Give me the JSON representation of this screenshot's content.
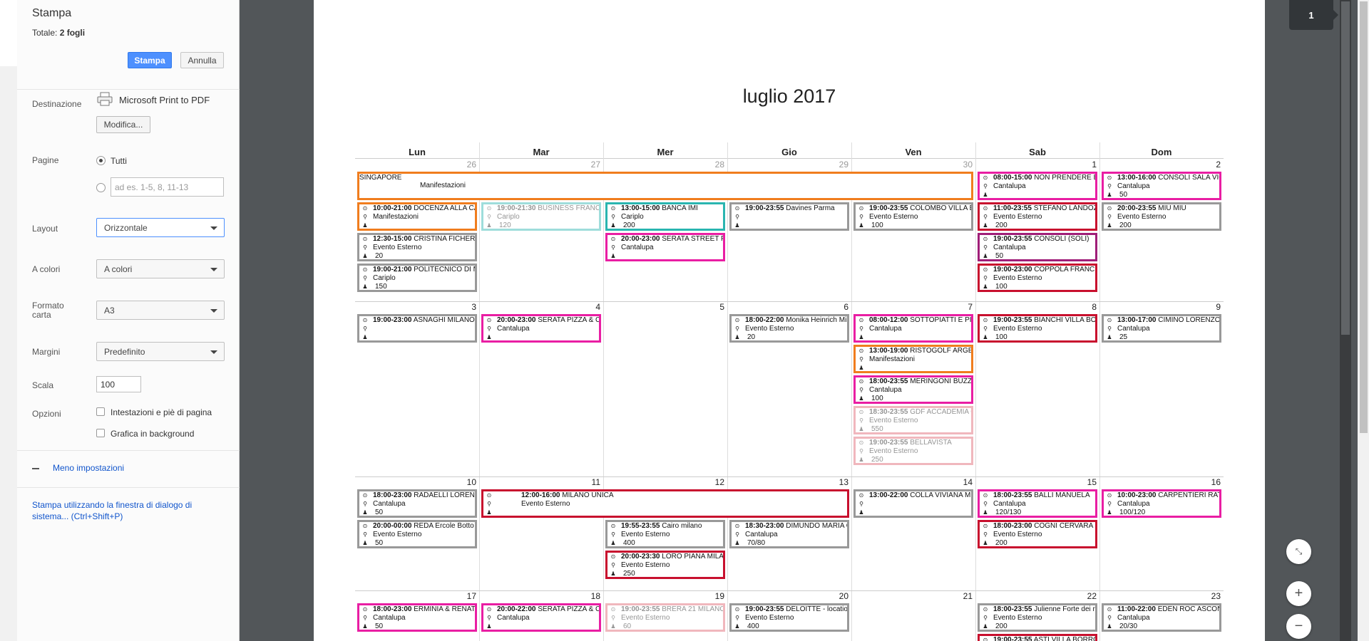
{
  "print_panel": {
    "title": "Stampa",
    "total_label": "Totale:",
    "total_value": "2 fogli",
    "print_button": "Stampa",
    "cancel_button": "Annulla",
    "destination_label": "Destinazione",
    "destination_value": "Microsoft Print to PDF",
    "modify_button": "Modifica...",
    "pages_label": "Pagine",
    "pages_all": "Tutti",
    "pages_range_placeholder": "ad es. 1-5, 8, 11-13",
    "layout_label": "Layout",
    "layout_value": "Orizzontale",
    "color_label": "A colori",
    "color_value": "A colori",
    "paper_label": "Formato carta",
    "paper_value": "A3",
    "margins_label": "Margini",
    "margins_value": "Predefinito",
    "scale_label": "Scala",
    "scale_value": "100",
    "options_label": "Opzioni",
    "option_headers": "Intestazioni e piè di pagina",
    "option_background": "Grafica in background",
    "less_settings": "Meno impostazioni",
    "system_dialog": "Stampa utilizzando la finestra di dialogo di sistema... (Ctrl+Shift+P)"
  },
  "viewer": {
    "page_number": "1",
    "fit_icon": "fit-page-icon",
    "zoom_in": "+",
    "zoom_out": "−"
  },
  "calendar": {
    "title": "luglio 2017",
    "days": [
      "Lun",
      "Mar",
      "Mer",
      "Gio",
      "Ven",
      "Sab",
      "Dom"
    ],
    "weeks": [
      {
        "dates": [
          "26",
          "27",
          "28",
          "29",
          "30",
          "1",
          "2"
        ],
        "other": [
          true,
          true,
          true,
          true,
          true,
          false,
          false
        ]
      },
      {
        "dates": [
          "3",
          "4",
          "5",
          "6",
          "7",
          "8",
          "9"
        ],
        "other": [
          false,
          false,
          false,
          false,
          false,
          false,
          false
        ]
      },
      {
        "dates": [
          "10",
          "11",
          "12",
          "13",
          "14",
          "15",
          "16"
        ],
        "other": [
          false,
          false,
          false,
          false,
          false,
          false,
          false
        ]
      },
      {
        "dates": [
          "17",
          "18",
          "19",
          "20",
          "21",
          "22",
          "23"
        ],
        "other": [
          false,
          false,
          false,
          false,
          false,
          false,
          false
        ]
      }
    ],
    "events": [
      {
        "week": 0,
        "col": 0,
        "span": 5,
        "row": 0,
        "color": "#f07d1e",
        "time": "",
        "title": "SINGAPORE",
        "place": "Manifestazioni",
        "people": "",
        "singlespan": true
      },
      {
        "week": 0,
        "col": 5,
        "span": 1,
        "row": 0,
        "color": "#e91ea3",
        "time": "08:00-15:00",
        "title": "NON PRENDERE BANQ",
        "place": "Cantalupa",
        "people": ""
      },
      {
        "week": 0,
        "col": 6,
        "span": 1,
        "row": 0,
        "color": "#e91ea3",
        "time": "13:00-16:00",
        "title": "CONSOLI SALA VIGNE",
        "place": "Cantalupa",
        "people": "50"
      },
      {
        "week": 0,
        "col": 0,
        "span": 1,
        "row": 1,
        "color": "#f07d1e",
        "time": "10:00-21:00",
        "title": "DOCENZA ALLA CATTO",
        "place": "Manifestazioni",
        "people": ""
      },
      {
        "week": 0,
        "col": 1,
        "span": 1,
        "row": 1,
        "color": "#2ab5b0",
        "time": "19:00-21:30",
        "title": "BUSINESS FRANCE",
        "place": "Cariplo",
        "people": "120",
        "faded": true
      },
      {
        "week": 0,
        "col": 2,
        "span": 1,
        "row": 1,
        "color": "#2ab5b0",
        "time": "13:00-15:00",
        "title": "BANCA IMI",
        "place": "Cariplo",
        "people": "200"
      },
      {
        "week": 0,
        "col": 3,
        "span": 1,
        "row": 1,
        "color": "#999999",
        "time": "19:00-23:55",
        "title": "Davines Parma",
        "place": "",
        "people": ""
      },
      {
        "week": 0,
        "col": 4,
        "span": 1,
        "row": 1,
        "color": "#999999",
        "time": "19:00-23:55",
        "title": "COLOMBO VILLA BOR",
        "place": "Evento Esterno",
        "people": "100"
      },
      {
        "week": 0,
        "col": 5,
        "span": 1,
        "row": 1,
        "color": "#c8102e",
        "time": "11:00-23:55",
        "title": "STEFANO LANDOZZI U",
        "place": "Evento Esterno",
        "people": "200"
      },
      {
        "week": 0,
        "col": 6,
        "span": 1,
        "row": 1,
        "color": "#999999",
        "time": "20:00-23:55",
        "title": "MIU MIU",
        "place": "Evento Esterno",
        "people": "200"
      },
      {
        "week": 0,
        "col": 0,
        "span": 1,
        "row": 2,
        "color": "#999999",
        "time": "12:30-15:00",
        "title": "CRISTINA FICHERA",
        "place": "Evento Esterno",
        "people": "20"
      },
      {
        "week": 0,
        "col": 2,
        "span": 1,
        "row": 2,
        "color": "#e91ea3",
        "time": "20:00-23:00",
        "title": "SERATA STREET FOOD",
        "place": "Cantalupa",
        "people": ""
      },
      {
        "week": 0,
        "col": 5,
        "span": 1,
        "row": 2,
        "color": "#a01e78",
        "time": "19:00-23:55",
        "title": "CONSOLI (SOLI)",
        "place": "Cantalupa",
        "people": "50"
      },
      {
        "week": 0,
        "col": 0,
        "span": 1,
        "row": 3,
        "color": "#999999",
        "time": "19:00-21:00",
        "title": "POLITECNICO DI MILA",
        "place": "Cariplo",
        "people": "150"
      },
      {
        "week": 0,
        "col": 5,
        "span": 1,
        "row": 3,
        "color": "#c8102e",
        "time": "19:00-23:00",
        "title": "COPPOLA FRANCESCA",
        "place": "Evento Esterno",
        "people": "100"
      },
      {
        "week": 1,
        "col": 0,
        "span": 1,
        "row": 0,
        "color": "#999999",
        "time": "19:00-23:00",
        "title": "ASNAGHI MILANO",
        "place": "",
        "people": ""
      },
      {
        "week": 1,
        "col": 1,
        "span": 1,
        "row": 0,
        "color": "#e91ea3",
        "time": "20:00-23:00",
        "title": "SERATA PIZZA & CHAM",
        "place": "Cantalupa",
        "people": ""
      },
      {
        "week": 1,
        "col": 3,
        "span": 1,
        "row": 0,
        "color": "#999999",
        "time": "18:00-22:00",
        "title": "Monika Heinrich Mila",
        "place": "Evento Esterno",
        "people": "20"
      },
      {
        "week": 1,
        "col": 4,
        "span": 1,
        "row": 0,
        "color": "#e91ea3",
        "time": "08:00-12:00",
        "title": "SOTTOPIATTI E PIATTI",
        "place": "Cantalupa",
        "people": ""
      },
      {
        "week": 1,
        "col": 5,
        "span": 1,
        "row": 0,
        "color": "#c8102e",
        "time": "19:00-23:55",
        "title": "BIANCHI VILLA BORRO",
        "place": "Evento Esterno",
        "people": "100"
      },
      {
        "week": 1,
        "col": 6,
        "span": 1,
        "row": 0,
        "color": "#999999",
        "time": "13:00-17:00",
        "title": "CIMINO LORENZO CA",
        "place": "Cantalupa",
        "people": "25"
      },
      {
        "week": 1,
        "col": 4,
        "span": 1,
        "row": 1,
        "color": "#f07d1e",
        "time": "13:00-19:00",
        "title": "RISTOGOLF ARGENTA",
        "place": "Manifestazioni",
        "people": ""
      },
      {
        "week": 1,
        "col": 4,
        "span": 1,
        "row": 2,
        "color": "#e91ea3",
        "time": "18:00-23:55",
        "title": "MERINGONI BUZZETT",
        "place": "Cantalupa",
        "people": "100"
      },
      {
        "week": 1,
        "col": 4,
        "span": 1,
        "row": 3,
        "color": "#e0616e",
        "time": "18:30-23:55",
        "title": "GDF ACCADEMIA Città",
        "place": "Evento Esterno",
        "people": "550",
        "faded": true
      },
      {
        "week": 1,
        "col": 4,
        "span": 1,
        "row": 4,
        "color": "#e0616e",
        "time": "19:00-23:55",
        "title": "BELLAVISTA",
        "place": "Evento Esterno",
        "people": "250",
        "faded": true
      },
      {
        "week": 2,
        "col": 0,
        "span": 1,
        "row": 0,
        "color": "#999999",
        "time": "18:00-23:00",
        "title": "RADAELLI LORENZO C",
        "place": "Cantalupa",
        "people": "50"
      },
      {
        "week": 2,
        "col": 1,
        "span": 3,
        "row": 0,
        "color": "#c8102e",
        "time": "12:00-16:00",
        "title": "MILANO UNICA",
        "place": "Evento Esterno",
        "people": "",
        "multispan": true
      },
      {
        "week": 2,
        "col": 4,
        "span": 1,
        "row": 0,
        "color": "#999999",
        "time": "13:00-22:00",
        "title": "COLLA VIVIANA MEDC",
        "place": "",
        "people": ""
      },
      {
        "week": 2,
        "col": 5,
        "span": 1,
        "row": 0,
        "color": "#e91ea3",
        "time": "18:00-23:55",
        "title": "BALLI MANUELA",
        "place": "Cantalupa",
        "people": "120/130"
      },
      {
        "week": 2,
        "col": 6,
        "span": 1,
        "row": 0,
        "color": "#e91ea3",
        "time": "10:00-23:00",
        "title": "CARPENTIERI RATTI",
        "place": "Cantalupa",
        "people": "100/120"
      },
      {
        "week": 2,
        "col": 0,
        "span": 1,
        "row": 1,
        "color": "#999999",
        "time": "20:00-00:00",
        "title": "REDA Ercole Botto - M",
        "place": "Evento Esterno",
        "people": "50"
      },
      {
        "week": 2,
        "col": 2,
        "span": 1,
        "row": 1,
        "color": "#999999",
        "time": "19:55-23:55",
        "title": "Cairo milano",
        "place": "Evento Esterno",
        "people": "400"
      },
      {
        "week": 2,
        "col": 3,
        "span": 1,
        "row": 1,
        "color": "#999999",
        "time": "18:30-23:00",
        "title": "DIMUNDO MARIA GRA",
        "place": "Cantalupa",
        "people": "70/80"
      },
      {
        "week": 2,
        "col": 5,
        "span": 1,
        "row": 1,
        "color": "#c8102e",
        "time": "18:00-23:00",
        "title": "COGNI CERVARA",
        "place": "Evento Esterno",
        "people": "200"
      },
      {
        "week": 2,
        "col": 2,
        "span": 1,
        "row": 2,
        "color": "#c8102e",
        "time": "20:00-23:30",
        "title": "LORO PIANA MILANO",
        "place": "Evento Esterno",
        "people": "250"
      },
      {
        "week": 3,
        "col": 0,
        "span": 1,
        "row": 0,
        "color": "#e91ea3",
        "time": "18:00-23:00",
        "title": "ERMINIA & RENATA CA",
        "place": "Cantalupa",
        "people": "50"
      },
      {
        "week": 3,
        "col": 1,
        "span": 1,
        "row": 0,
        "color": "#e91ea3",
        "time": "20:00-22:00",
        "title": "SERATA PIZZA & CHAM",
        "place": "Cantalupa",
        "people": ""
      },
      {
        "week": 3,
        "col": 2,
        "span": 1,
        "row": 0,
        "color": "#e0616e",
        "time": "19:00-23:55",
        "title": "BRERA 21 MILANO",
        "place": "Evento Esterno",
        "people": "60",
        "faded": true
      },
      {
        "week": 3,
        "col": 3,
        "span": 1,
        "row": 0,
        "color": "#999999",
        "time": "19:00-23:55",
        "title": "DELOITTE - location d",
        "place": "Evento Esterno",
        "people": "400"
      },
      {
        "week": 3,
        "col": 5,
        "span": 1,
        "row": 0,
        "color": "#999999",
        "time": "18:00-23:55",
        "title": "Julienne Forte dei mai",
        "place": "Evento Esterno",
        "people": "200"
      },
      {
        "week": 3,
        "col": 6,
        "span": 1,
        "row": 0,
        "color": "#999999",
        "time": "11:00-22:00",
        "title": "EDEN ROC ASCONA",
        "place": "Cantalupa",
        "people": "20/30"
      },
      {
        "week": 3,
        "col": 5,
        "span": 1,
        "row": 1,
        "color": "#c8102e",
        "time": "19:00-23:55",
        "title": "ASTI VILLA BORROMEO",
        "place": "",
        "people": ""
      }
    ]
  }
}
